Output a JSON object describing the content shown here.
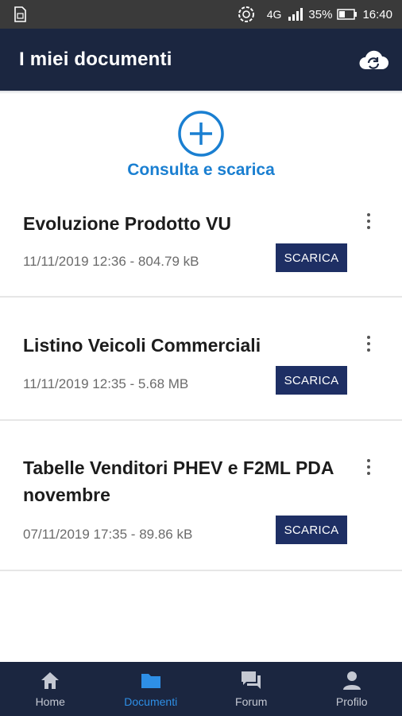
{
  "status_bar": {
    "network": "4G",
    "battery": "35%",
    "time": "16:40",
    "icons": [
      "sim-icon",
      "sync-icon",
      "signal-icon",
      "battery-icon"
    ]
  },
  "header": {
    "title": "I miei documenti",
    "action_icon": "cloud-sync-icon"
  },
  "consulta": {
    "label": "Consulta e scarica",
    "icon": "plus-circle-icon",
    "color": "#1a7fd1"
  },
  "documents": [
    {
      "title": "Evoluzione Prodotto VU",
      "meta": "11/11/2019 12:36 - 804.79 kB",
      "action": "SCARICA"
    },
    {
      "title": "Listino Veicoli Commerciali",
      "meta": "11/11/2019 12:35 - 5.68 MB",
      "action": "SCARICA"
    },
    {
      "title": "Tabelle Venditori PHEV e F2ML PDA novembre",
      "meta": "07/11/2019 17:35 - 89.86 kB",
      "action": "SCARICA"
    }
  ],
  "bottom_nav": {
    "items": [
      {
        "label": "Home",
        "icon": "home-icon"
      },
      {
        "label": "Documenti",
        "icon": "folder-icon",
        "active": true
      },
      {
        "label": "Forum",
        "icon": "forum-icon"
      },
      {
        "label": "Profilo",
        "icon": "person-icon"
      }
    ]
  },
  "colors": {
    "primary_dark": "#1b2640",
    "button": "#1e2f64",
    "accent": "#1a7fd1",
    "nav_active": "#2e8fe6"
  }
}
